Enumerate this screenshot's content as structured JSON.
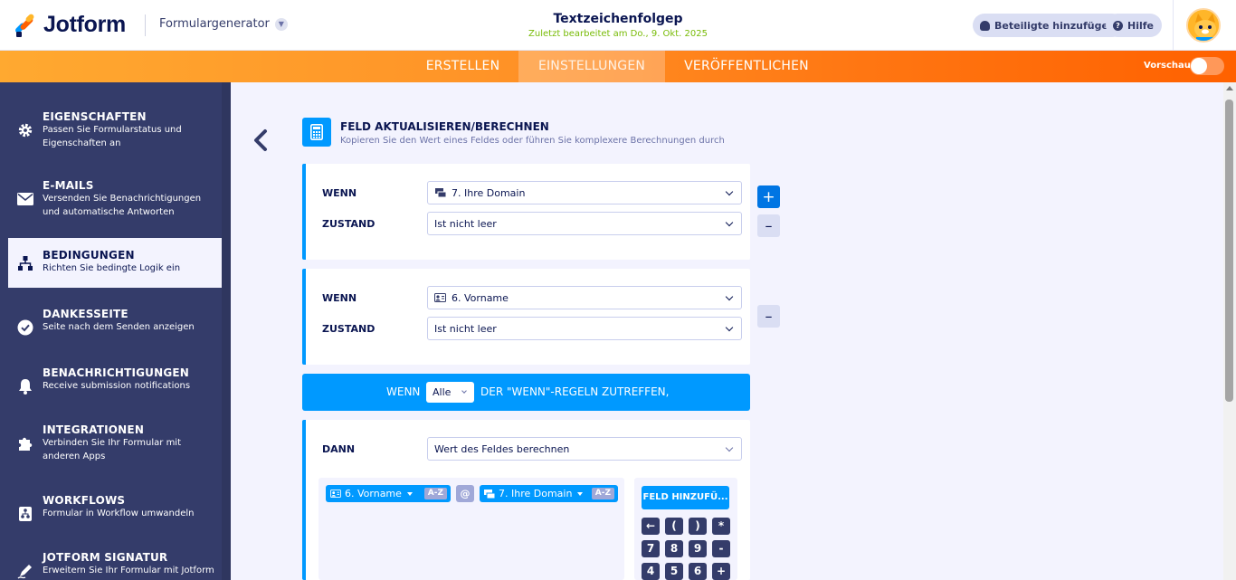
{
  "header": {
    "logo_text": "Jotform",
    "form_generator": "Formulargenerator",
    "form_title": "Textzeichenfolgep",
    "last_edited": "Zuletzt bearbeitet am Do., 9. Okt. 2025",
    "add_participants": "Beteiligte hinzufügen",
    "help": "Hilfe"
  },
  "nav": {
    "tabs": [
      "ERSTELLEN",
      "EINSTELLUNGEN",
      "VERÖFFENTLICHEN"
    ],
    "active_tab": "EINSTELLUNGEN",
    "preview_label": "Vorschau"
  },
  "sidebar": {
    "items": [
      {
        "title": "EIGENSCHAFTEN",
        "desc": "Passen Sie Formularstatus und Eigenschaften an",
        "icon": "gear-icon"
      },
      {
        "title": "E-MAILS",
        "desc": "Versenden Sie Benachrichtigungen und automatische Antworten",
        "icon": "envelope-icon"
      },
      {
        "title": "BEDINGUNGEN",
        "desc": "Richten Sie bedingte Logik ein",
        "icon": "sitemap-icon",
        "active": true
      },
      {
        "title": "DANKESSEITE",
        "desc": "Seite nach dem Senden anzeigen",
        "icon": "check-circle-icon"
      },
      {
        "title": "BENACHRICHTIGUNGEN",
        "desc": "Receive submission notifications",
        "icon": "bell-icon"
      },
      {
        "title": "INTEGRATIONEN",
        "desc": "Verbinden Sie Ihr Formular mit anderen Apps",
        "icon": "puzzle-icon"
      },
      {
        "title": "WORKFLOWS",
        "desc": "Formular in Workflow umwandeln",
        "icon": "workflow-icon"
      },
      {
        "title": "JOTFORM SIGNATUR",
        "desc": "Erweitern Sie Ihr Formular mit Jotform",
        "icon": "signature-icon"
      }
    ]
  },
  "condition": {
    "title": "FELD AKTUALISIEREN/BERECHNEN",
    "subtitle": "Kopieren Sie den Wert eines Feldes oder führen Sie komplexere Berechnungen durch",
    "rules": [
      {
        "if_label": "WENN",
        "field": "7. Ihre Domain",
        "state_label": "ZUSTAND",
        "state": "Ist nicht leer"
      },
      {
        "if_label": "WENN",
        "field": "6. Vorname",
        "state_label": "ZUSTAND",
        "state": "Ist nicht leer"
      }
    ],
    "plus": "+",
    "minus": "–",
    "match_bar": {
      "if": "WENN",
      "quantifier": "Alle",
      "suffix": "DER \"WENN\"-REGELN ZUTREFFEN,"
    },
    "then": {
      "label": "DANN",
      "action": "Wert des Feldes berechnen",
      "formula": [
        {
          "field": "6. Vorname",
          "badge": "A-Z"
        },
        {
          "op": "@"
        },
        {
          "field": "7. Ihre Domain",
          "badge": "A-Z"
        }
      ],
      "add_field": "FELD HINZUFÜ...",
      "keys": [
        "←",
        "(",
        ")",
        "*",
        "7",
        "8",
        "9",
        "-",
        "4",
        "5",
        "6",
        "+"
      ]
    }
  },
  "colors": {
    "accent_blue": "#0099ff",
    "sidebar_bg": "#343c6a",
    "orange_start": "#ffa930",
    "orange_end": "#ff6100",
    "edited_green": "#78bb07"
  }
}
